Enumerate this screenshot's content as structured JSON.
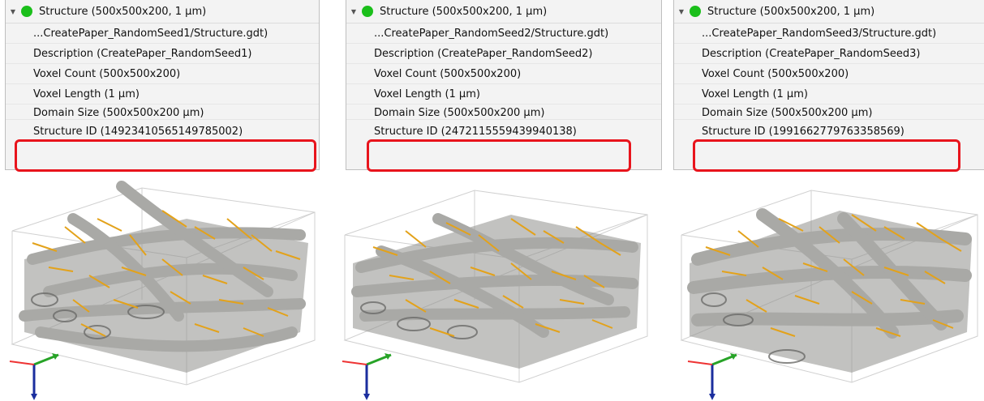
{
  "panels": [
    {
      "header": "Structure (500x500x200, 1 µm)",
      "rows": [
        "...CreatePaper_RandomSeed1/Structure.gdt)",
        "Description (CreatePaper_RandomSeed1)",
        "Voxel Count (500x500x200)",
        "Voxel Length (1 µm)",
        "Domain Size (500x500x200 µm)",
        "Structure ID (14923410565149785002)"
      ]
    },
    {
      "header": "Structure (500x500x200, 1 µm)",
      "rows": [
        "...CreatePaper_RandomSeed2/Structure.gdt)",
        "Description (CreatePaper_RandomSeed2)",
        "Voxel Count (500x500x200)",
        "Voxel Length (1 µm)",
        "Domain Size (500x500x200 µm)",
        "Structure ID (247211555943994013​8)"
      ]
    },
    {
      "header": "Structure (500x500x200, 1 µm)",
      "rows": [
        "...CreatePaper_RandomSeed3/Structure.gdt)",
        "Description (CreatePaper_RandomSeed3)",
        "Voxel Count (500x500x200)",
        "Voxel Length (1 µm)",
        "Domain Size (500x500x200 µm)",
        "Structure ID (1991662779763358569)"
      ]
    }
  ],
  "colors": {
    "status_dot": "#1bbf1b",
    "highlight": "#e8141c",
    "fiber_gray": "#a9a9a6",
    "fiber_yellow": "#e3a21a"
  }
}
